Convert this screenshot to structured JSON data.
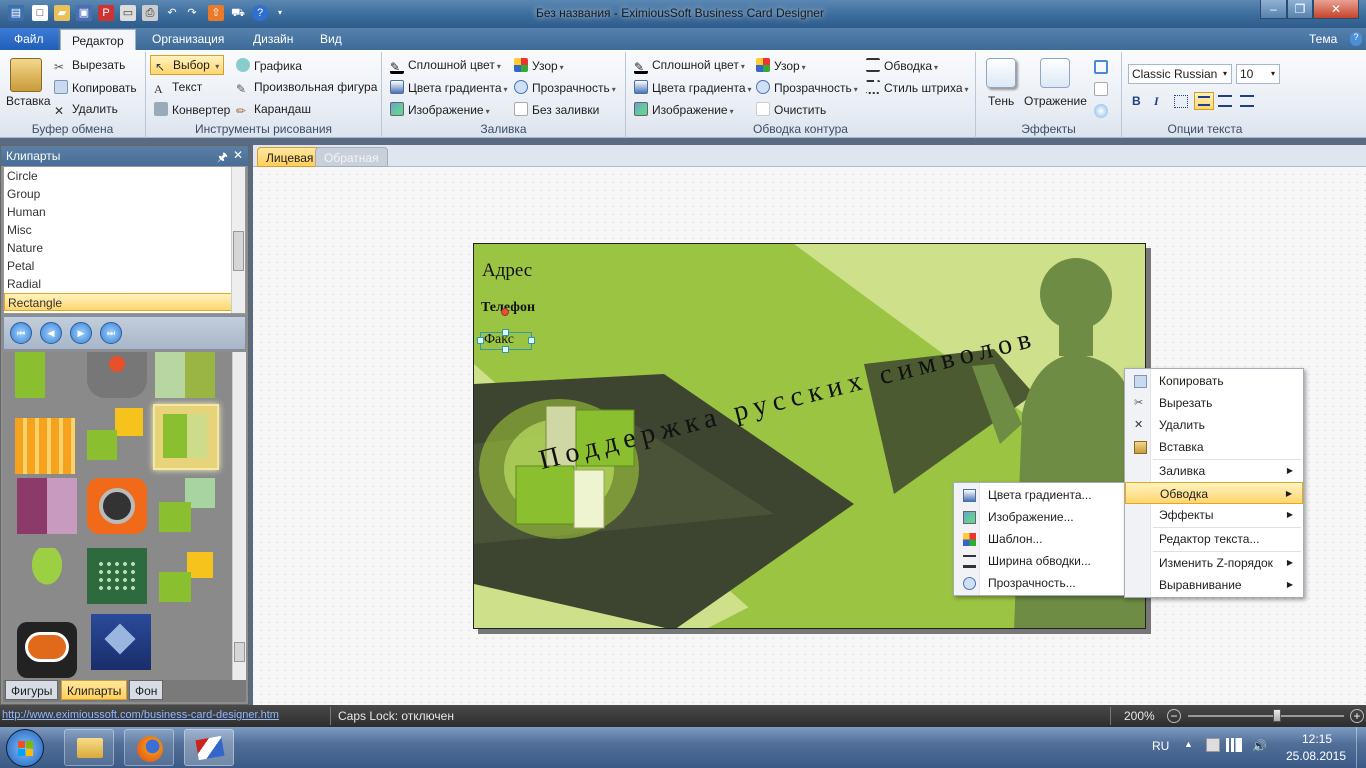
{
  "window": {
    "title": "Без названия - EximiousSoft Business Card Designer",
    "minimize": "–",
    "maximize": "❐",
    "close": "✕",
    "theme_label": "Тема"
  },
  "menu": {
    "tabs": [
      "Файл",
      "Редактор",
      "Организация",
      "Дизайн",
      "Вид"
    ],
    "active": "Редактор"
  },
  "ribbon": {
    "clipboard": {
      "label": "Буфер обмена",
      "paste": "Вставка",
      "cut": "Вырезать",
      "copy": "Копировать",
      "delete": "Удалить"
    },
    "drawing": {
      "label": "Инструменты рисования",
      "select": "Выбор",
      "text": "Текст",
      "converter": "Конвертер",
      "graphics": "Графика",
      "freeform": "Произвольная фигура",
      "pencil": "Карандаш"
    },
    "fill": {
      "label": "Заливка",
      "solid": "Сплошной цвет",
      "gradient": "Цвета градиента",
      "image": "Изображение",
      "pattern": "Узор",
      "transparency": "Прозрачность",
      "none": "Без заливки"
    },
    "outline": {
      "label": "Обводка контура",
      "solid": "Сплошной цвет",
      "gradient": "Цвета градиента",
      "image": "Изображение",
      "pattern": "Узор",
      "transparency": "Прозрачность",
      "clear": "Очистить",
      "stroke": "Обводка",
      "dash": "Стиль штриха"
    },
    "effects": {
      "label": "Эффекты",
      "shadow": "Тень",
      "reflection": "Отражение"
    },
    "text": {
      "label": "Опции текста",
      "font": "Classic Russian",
      "size": "10",
      "bold": "B",
      "italic": "I"
    }
  },
  "clipart_panel": {
    "title": "Клипарты",
    "pin": "🖈",
    "close": "✕",
    "items": [
      "Circle",
      "Group",
      "Human",
      "Misc",
      "Nature",
      "Petal",
      "Radial",
      "Rectangle"
    ],
    "selected": "Rectangle",
    "nav": [
      "⏮",
      "◀",
      "▶",
      "⏭"
    ],
    "tabs": [
      "Фигуры",
      "Клипарты",
      "Фон"
    ],
    "active_tab": "Клипарты"
  },
  "document": {
    "tabs": [
      "Лицевая",
      "Обратная"
    ],
    "active_tab": "Лицевая"
  },
  "card": {
    "address": "Адрес",
    "phone": "Телефон",
    "fax": "Факс",
    "slogan": "Поддержка русских символов",
    "colors": {
      "bg": "#cfe08a",
      "mid": "#8fb83c",
      "dark": "#3f4a2a",
      "figure": "#6e8c44"
    }
  },
  "context_menu": {
    "items": [
      {
        "label": "Копировать",
        "icon": "copy-icon"
      },
      {
        "label": "Вырезать",
        "icon": "cut-icon"
      },
      {
        "label": "Удалить",
        "icon": "delete-icon"
      },
      {
        "label": "Вставка",
        "icon": "paste-icon"
      },
      {
        "label": "Заливка",
        "submenu": true
      },
      {
        "label": "Обводка",
        "submenu": true,
        "highlighted": true
      },
      {
        "label": "Эффекты",
        "submenu": true
      },
      {
        "label": "Редактор текста..."
      },
      {
        "label": "Изменить Z-порядок",
        "submenu": true
      },
      {
        "label": "Выравнивание",
        "submenu": true
      }
    ]
  },
  "submenu": {
    "items": [
      {
        "label": "Цвета градиента...",
        "icon": "gradient-icon"
      },
      {
        "label": "Изображение...",
        "icon": "image-icon"
      },
      {
        "label": "Шаблон...",
        "icon": "pattern-icon"
      },
      {
        "label": "Ширина обводки...",
        "icon": "width-icon"
      },
      {
        "label": "Прозрачность...",
        "icon": "transparency-icon"
      }
    ]
  },
  "statusbar": {
    "link": "http://www.eximioussoft.com/business-card-designer.htm",
    "capslock": "Caps Lock: отключен",
    "zoom": "200%"
  },
  "taskbar": {
    "lang": "RU",
    "time": "12:15",
    "date": "25.08.2015"
  }
}
